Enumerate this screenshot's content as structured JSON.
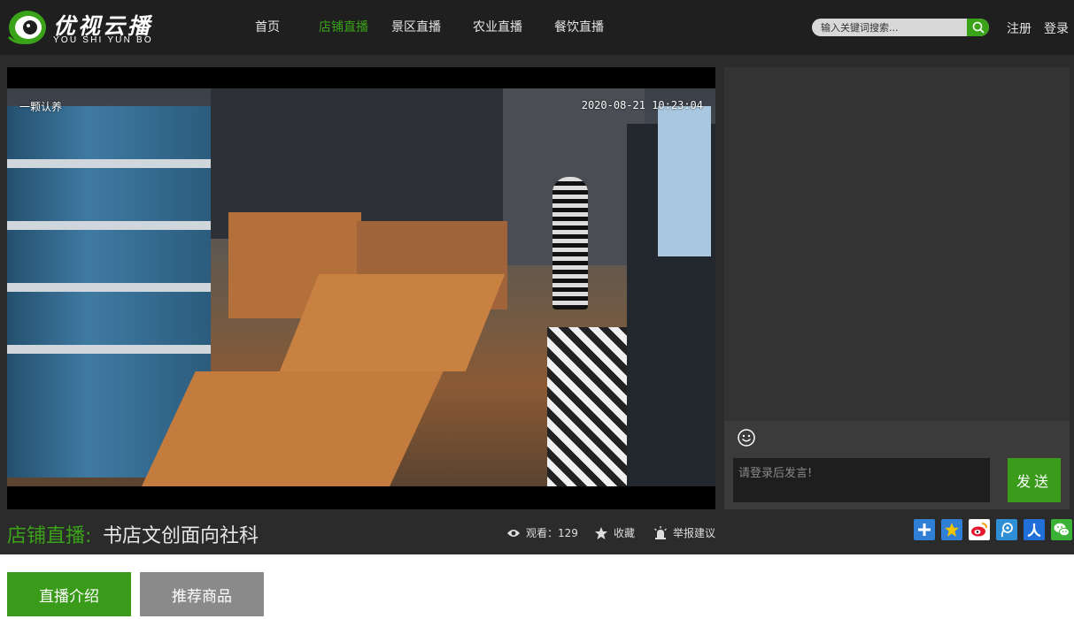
{
  "brand": {
    "logo_text": "优视云播",
    "logo_sub": "YOU SHI YUN BO",
    "accent": "#3aa319"
  },
  "nav": {
    "items": [
      {
        "label": "首页",
        "active": false
      },
      {
        "label": "店铺直播",
        "active": true
      },
      {
        "label": "景区直播",
        "active": false
      },
      {
        "label": "农业直播",
        "active": false
      },
      {
        "label": "餐饮直播",
        "active": false
      }
    ]
  },
  "search": {
    "placeholder": "输入关键词搜索..."
  },
  "auth": {
    "register": "注册",
    "login": "登录"
  },
  "video": {
    "overlay_label": "一颗认养",
    "timestamp": "2020-08-21 10:23:04"
  },
  "chat": {
    "input_placeholder": "请登录后发言!",
    "send_label": "发送"
  },
  "stream": {
    "category": "店铺直播:",
    "name": "书店文创面向社科",
    "views_label": "观看：129",
    "favorite_label": "收藏",
    "report_label": "举报建议"
  },
  "share_icons": [
    "plus-share-icon",
    "qzone-icon",
    "weibo-icon",
    "tencent-weibo-icon",
    "renren-icon",
    "wechat-icon"
  ],
  "tabs": [
    {
      "label": "直播介绍",
      "active": true,
      "color": "#3a9a19"
    },
    {
      "label": "推荐商品",
      "active": false,
      "color": "#8a8a8a"
    }
  ]
}
